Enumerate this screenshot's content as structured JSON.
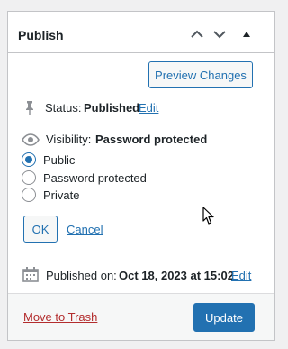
{
  "panel": {
    "title": "Publish",
    "controls": {
      "move_up_icon": "chevron-up-icon",
      "move_down_icon": "chevron-down-icon",
      "toggle_icon": "caret-up-icon"
    }
  },
  "preview_button": "Preview Changes",
  "status": {
    "icon": "pin-icon",
    "label": "Status:",
    "value": "Published",
    "edit_link": "Edit"
  },
  "visibility": {
    "icon": "eye-icon",
    "label": "Visibility:",
    "value": "Password protected",
    "options": [
      {
        "label": "Public",
        "checked": true
      },
      {
        "label": "Password protected",
        "checked": false
      },
      {
        "label": "Private",
        "checked": false
      }
    ],
    "ok_button": "OK",
    "cancel_link": "Cancel"
  },
  "published": {
    "icon": "calendar-icon",
    "label": "Published on:",
    "value": "Oct 18, 2023 at 15:02",
    "edit_link": "Edit"
  },
  "footer": {
    "trash_link": "Move to Trash",
    "update_button": "Update"
  },
  "colors": {
    "accent": "#2271b1",
    "danger": "#b32d2e",
    "border": "#c3c4c7",
    "text": "#1d2327"
  }
}
